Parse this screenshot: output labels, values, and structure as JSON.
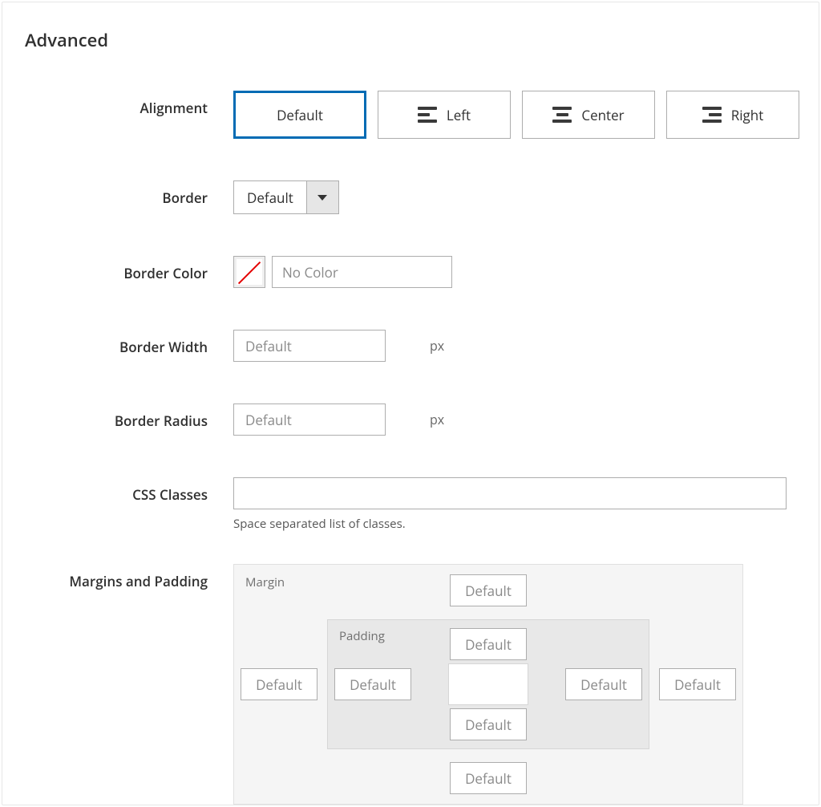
{
  "section": {
    "title": "Advanced"
  },
  "alignment": {
    "label": "Alignment",
    "options": [
      {
        "label": "Default"
      },
      {
        "label": "Left"
      },
      {
        "label": "Center"
      },
      {
        "label": "Right"
      }
    ],
    "selected_index": 0
  },
  "border": {
    "label": "Border",
    "value": "Default"
  },
  "border_color": {
    "label": "Border Color",
    "placeholder": "No Color",
    "value": ""
  },
  "border_width": {
    "label": "Border Width",
    "placeholder": "Default",
    "unit": "px",
    "value": ""
  },
  "border_radius": {
    "label": "Border Radius",
    "placeholder": "Default",
    "unit": "px",
    "value": ""
  },
  "css_classes": {
    "label": "CSS Classes",
    "value": "",
    "hint": "Space separated list of classes."
  },
  "margins_padding": {
    "label": "Margins and Padding",
    "margin_label": "Margin",
    "padding_label": "Padding",
    "placeholder": "Default",
    "margin": {
      "top": "",
      "right": "",
      "bottom": "",
      "left": ""
    },
    "padding": {
      "top": "",
      "right": "",
      "bottom": "",
      "left": ""
    }
  }
}
